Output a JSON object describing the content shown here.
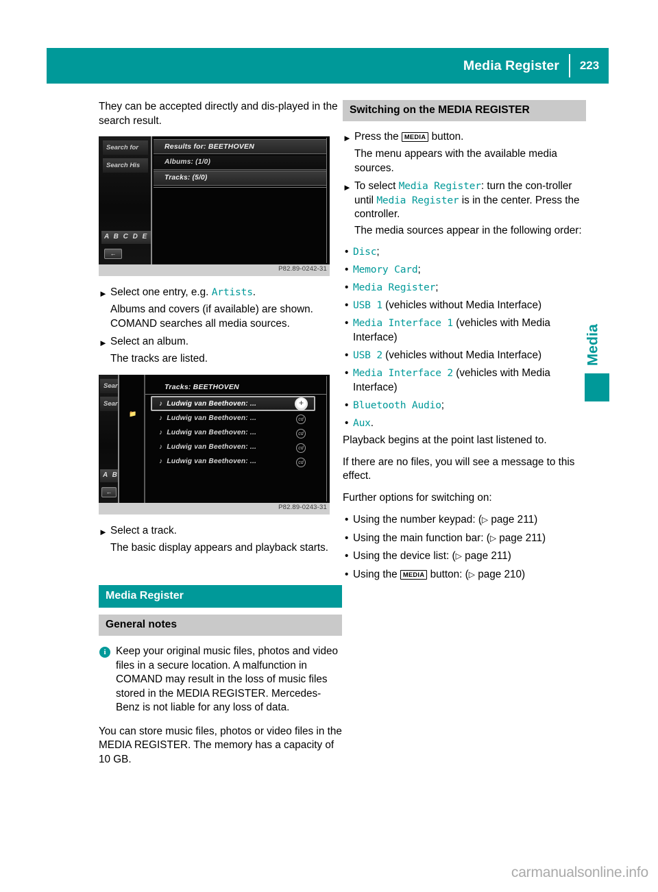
{
  "header": {
    "title": "Media Register",
    "page_number": "223"
  },
  "side_tab": {
    "label": "Media"
  },
  "watermark": "carmanualsonline.info",
  "left_column": {
    "intro": "They can be accepted directly and dis-played in the search result.",
    "figure1": {
      "caption_id": "P82.89-0242-31",
      "left_items": [
        "Search for",
        "Search His"
      ],
      "alpha_bar": "A B C D E",
      "back_icon": "back-arrow-icon",
      "title": "Results for: BEETHOVEN",
      "rows": [
        "Albums: (1/0)",
        "Tracks: (5/0)"
      ]
    },
    "step1": {
      "marker": "X",
      "text_before": "Select one entry, e.g. ",
      "highlight": "Artists",
      "text_after": "."
    },
    "step1_sub1": "Albums and covers (if available) are shown.",
    "step1_sub2": "COMAND searches all media sources.",
    "step2": {
      "marker": "X",
      "text": "Select an album."
    },
    "step2_sub": "The tracks are listed.",
    "figure2": {
      "caption_id": "P82.89-0243-31",
      "left_items": [
        "Sear",
        "Sear"
      ],
      "alpha_bar": "A B",
      "back_icon": "back-arrow-icon",
      "title": "Tracks: BEETHOVEN",
      "rows": [
        "Ludwig van Beethoven: ...",
        "Ludwig van Beethoven: ...",
        "Ludwig van Beethoven: ...",
        "Ludwig van Beethoven: ...",
        "Ludwig van Beethoven: ..."
      ]
    },
    "step3": {
      "marker": "X",
      "text": "Select a track."
    },
    "step3_sub": "The basic display appears and playback starts.",
    "heading_teal": "Media Register",
    "heading_gray": "General notes",
    "note": {
      "icon": "info-icon",
      "text": "Keep your original music files, photos and video files in a secure location. A malfunction in COMAND may result in the loss of music files stored in the MEDIA REGISTER. Mercedes-Benz is not liable for any loss of data."
    },
    "closing": "You can store music files, photos or video files in the MEDIA REGISTER. The memory has a capacity of 10 GB."
  },
  "right_column": {
    "heading_gray": "Switching on the MEDIA REGISTER",
    "step1": {
      "marker": "X",
      "before": "Press the ",
      "key": "MEDIA",
      "after": " button."
    },
    "step1_sub": "The menu appears with the available media sources.",
    "step2": {
      "marker": "X",
      "before": "To select ",
      "highlight1": "Media Register",
      "middle": ": turn the con-troller until ",
      "highlight2": "Media Register",
      "after": " is in the center. Press the controller."
    },
    "step2_sub": "The media sources appear in the following order:",
    "sources": [
      {
        "code": "Disc",
        "suffix": ";"
      },
      {
        "code": "Memory Card",
        "suffix": ";"
      },
      {
        "code": "Media Register",
        "suffix": ";"
      },
      {
        "code": "USB 1",
        "suffix": " (vehicles without Media Interface)"
      },
      {
        "code": "Media Interface 1",
        "suffix": " (vehicles with Media Interface)"
      },
      {
        "code": "USB 2",
        "suffix": " (vehicles without Media Interface)"
      },
      {
        "code": "Media Interface 2",
        "suffix": " (vehicles with Media Interface)"
      },
      {
        "code": "Bluetooth Audio",
        "suffix": ";"
      },
      {
        "code": "Aux",
        "suffix": "."
      }
    ],
    "para1": "Playback begins at the point last listened to.",
    "para2": "If there are no files, you will see a message to this effect.",
    "para3": "Further options for switching on:",
    "options": [
      {
        "text": "Using the number keypad: (",
        "ref": "page 211",
        "close": ")"
      },
      {
        "text": "Using the main function bar: (",
        "ref": "page 211",
        "close": ")"
      },
      {
        "text": "Using the device list: (",
        "ref": "page 211",
        "close": ")"
      },
      {
        "text_before_key": "Using the ",
        "key": "MEDIA",
        "text_after_key": " button: (",
        "ref": "page 210",
        "close": ")"
      }
    ]
  },
  "colors": {
    "accent": "#009999",
    "gray_heading": "#c9c9c9",
    "watermark": "#aaaaaa"
  }
}
